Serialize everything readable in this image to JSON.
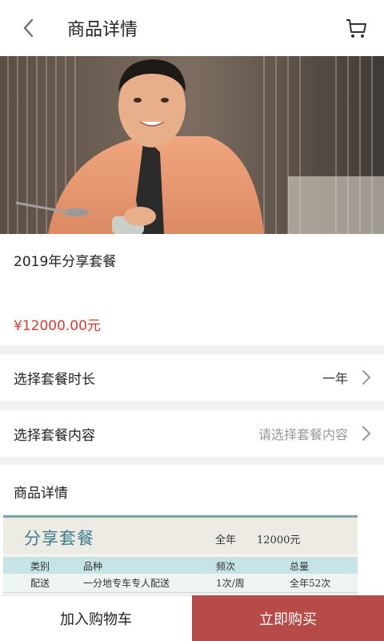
{
  "header": {
    "title": "商品详情",
    "back_icon": "chevron-left-icon",
    "cart_icon": "cart-icon"
  },
  "product": {
    "name": "2019年分享套餐",
    "price": "¥12000.00元"
  },
  "options": [
    {
      "label": "选择套餐时长",
      "value": "一年"
    },
    {
      "label": "选择套餐内容",
      "value": "请选择套餐内容"
    }
  ],
  "detail": {
    "title": "商品详情",
    "package_card": {
      "name": "分享套餐",
      "year_label": "全年",
      "price": "12000元",
      "columns": [
        "类别",
        "品种",
        "频次",
        "总量"
      ],
      "row": [
        "配送",
        "一分地专车专人配送",
        "1次/周",
        "全年52次"
      ]
    }
  },
  "actions": {
    "add_to_cart": "加入购物车",
    "buy_now": "立即购买"
  },
  "colors": {
    "price": "#e23a32",
    "buy_button": "#b54a47",
    "option_value_active": "#333333",
    "option_value_placeholder": "#999999"
  }
}
